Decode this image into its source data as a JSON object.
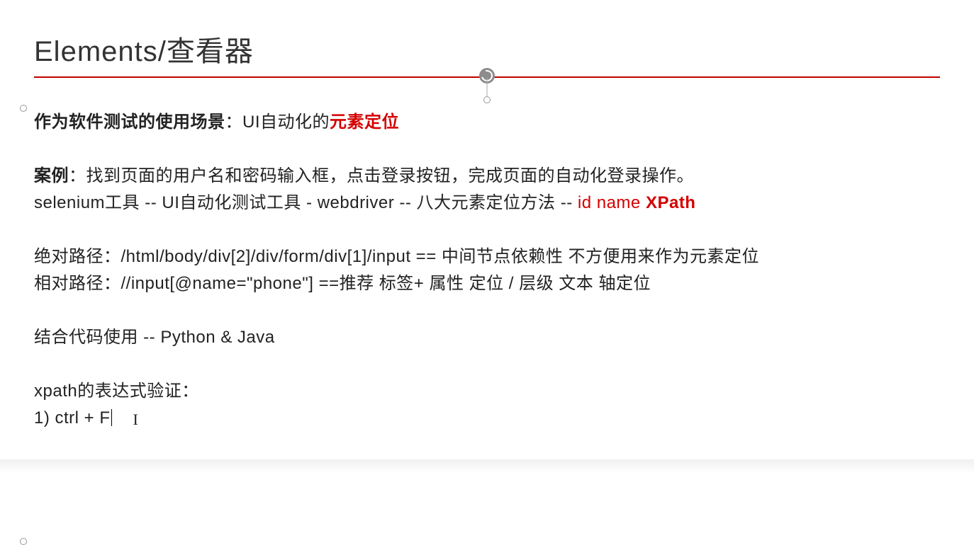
{
  "title": "Elements/查看器",
  "line1_prefix_bold": "作为软件测试的使用场景",
  "line1_mid": "：UI自动化的",
  "line1_red": "元素定位",
  "line2_bold": "案例",
  "line2_rest": "：找到页面的用户名和密码输入框，点击登录按钮，完成页面的自动化登录操作。",
  "line3_front": "selenium工具  -- UI自动化测试工具 - webdriver  -- 八大元素定位方法 -- ",
  "line3_id": "id",
  "line3_gap": "  ",
  "line3_name": "name",
  "line3_gap2": "   ",
  "line3_xpath": "XPath",
  "line4": "绝对路径：/html/body/div[2]/div/form/div[1]/input == 中间节点依赖性   不方便用来作为元素定位",
  "line5": "相对路径：//input[@name=\"phone\"]   ==推荐   标签+ 属性 定位 / 层级 文本  轴定位",
  "line6": "结合代码使用 -- Python & Java",
  "line7": "xpath的表达式验证：",
  "line8": "1)  ctrl + F",
  "ibeam_glyph": "I"
}
